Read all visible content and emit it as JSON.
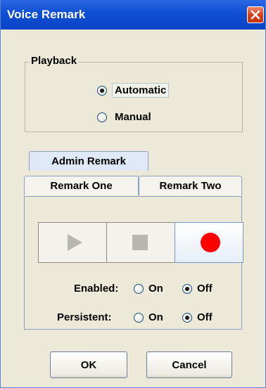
{
  "window": {
    "title": "Voice Remark"
  },
  "playback": {
    "legend": "Playback",
    "options": [
      {
        "label": "Automatic",
        "checked": true
      },
      {
        "label": "Manual",
        "checked": false
      }
    ]
  },
  "tabs": {
    "row_top": [
      "Admin Remark"
    ],
    "row_bottom": [
      "Remark One",
      "Remark Two"
    ],
    "selected": "Admin Remark"
  },
  "transport": {
    "buttons": [
      {
        "icon": "play-icon",
        "enabled": false
      },
      {
        "icon": "stop-icon",
        "enabled": false
      },
      {
        "icon": "record-icon",
        "enabled": true,
        "color": "#ff0000"
      }
    ]
  },
  "settings": {
    "enabled": {
      "label": "Enabled:",
      "on_label": "On",
      "off_label": "Off",
      "value": "Off"
    },
    "persistent": {
      "label": "Persistent:",
      "on_label": "On",
      "off_label": "Off",
      "value": "Off"
    }
  },
  "buttons": {
    "ok": "OK",
    "cancel": "Cancel"
  },
  "colors": {
    "titlebar": "#0e4fd3",
    "window_bg": "#ece9d8",
    "record": "#ff0000"
  }
}
